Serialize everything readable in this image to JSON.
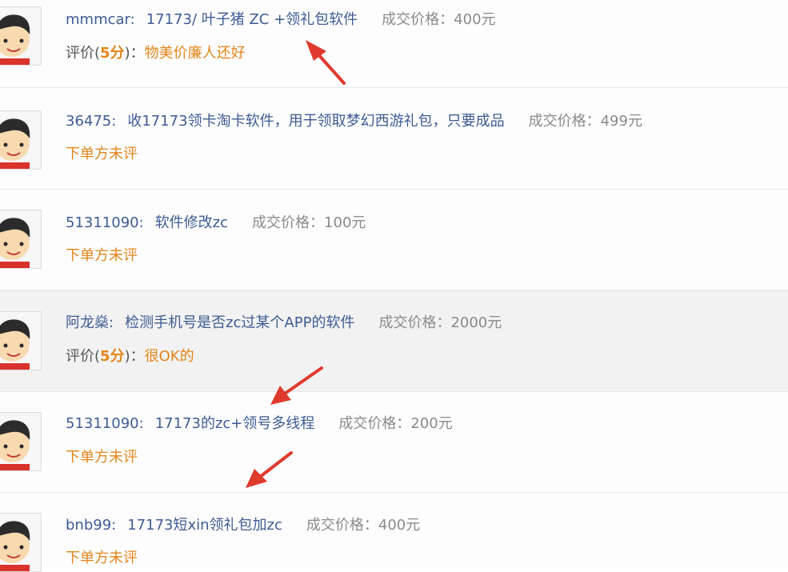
{
  "colors": {
    "link": "#3d5b94",
    "price": "#8a8a8a",
    "accent": "#e3851a",
    "arrow": "#e03a2e",
    "shaded_row": "#f2f2f2"
  },
  "rows": [
    {
      "user": "mmmcar:",
      "title": "17173/ 叶子猪 ZC +领礼包软件",
      "price": "成交价格：400元",
      "review_label": "评价(",
      "score": "5分",
      "review_close": ")：",
      "comment": "物美价廉人还好",
      "unrated": ""
    },
    {
      "user": "36475:",
      "title": "收17173领卡淘卡软件，用于领取梦幻西游礼包，只要成品",
      "price": "成交价格：499元",
      "review_label": "",
      "score": "",
      "review_close": "",
      "comment": "",
      "unrated": "下单方未评"
    },
    {
      "user": "51311090:",
      "title": "软件修改zc",
      "price": "成交价格：100元",
      "review_label": "",
      "score": "",
      "review_close": "",
      "comment": "",
      "unrated": "下单方未评"
    },
    {
      "user": "阿龙燊:",
      "title": "检测手机号是否zc过某个APP的软件",
      "price": "成交价格：2000元",
      "review_label": "评价(",
      "score": "5分",
      "review_close": ")：",
      "comment": "很OK的",
      "unrated": ""
    },
    {
      "user": "51311090:",
      "title": "17173的zc+领号多线程",
      "price": "成交价格：200元",
      "review_label": "",
      "score": "",
      "review_close": "",
      "comment": "",
      "unrated": "下单方未评"
    },
    {
      "user": "bnb99:",
      "title": "17173短xin领礼包加zc",
      "price": "成交价格：400元",
      "review_label": "",
      "score": "",
      "review_close": "",
      "comment": "",
      "unrated": "下单方未评"
    }
  ]
}
